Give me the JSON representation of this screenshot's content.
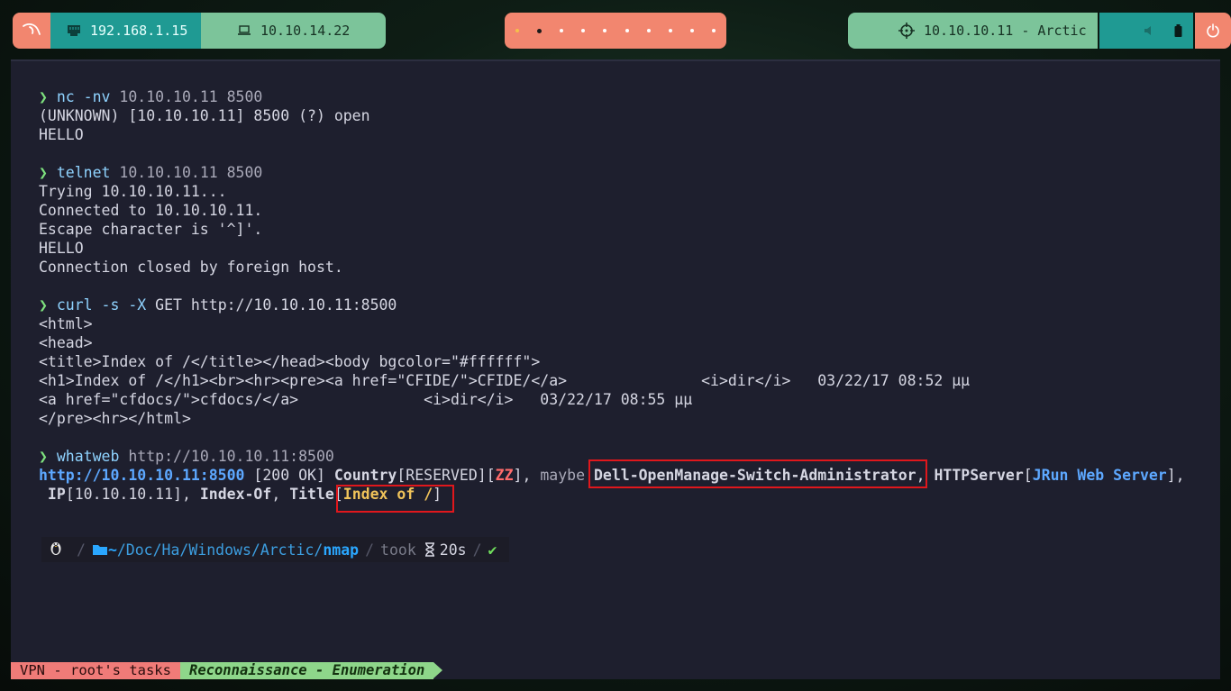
{
  "topbar": {
    "ethernet_ip": "192.168.1.15",
    "vpn_ip": "10.10.14.22",
    "target": "10.10.10.11 - Arctic",
    "workspaces": 10,
    "active_workspace": 2,
    "colors": {
      "coral": "#f2866f",
      "teal": "#1f9a93",
      "green": "#7cc49a"
    }
  },
  "terminal": {
    "lines": [
      {
        "prompt": "❯ ",
        "cmd": "nc -nv",
        "args": " 10.10.10.11 8500"
      },
      {
        "text": "(UNKNOWN) [10.10.10.11] 8500 (?) open"
      },
      {
        "text": "HELLO"
      },
      {
        "text": ""
      },
      {
        "prompt": "❯ ",
        "cmd": "telnet",
        "args": " 10.10.10.11 8500"
      },
      {
        "text": "Trying 10.10.10.11..."
      },
      {
        "text": "Connected to 10.10.10.11."
      },
      {
        "text": "Escape character is '^]'."
      },
      {
        "text": "HELLO"
      },
      {
        "text": "Connection closed by foreign host."
      },
      {
        "text": ""
      },
      {
        "prompt": "❯ ",
        "cmd": "curl -s -X",
        "args": " GET http://10.10.10.11:8500"
      },
      {
        "text": "<html>"
      },
      {
        "text": "<head>"
      },
      {
        "text": "<title>Index of /</title></head><body bgcolor=\"#ffffff\">"
      },
      {
        "text": "<h1>Index of /</h1><br><hr><pre><a href=\"CFIDE/\">CFIDE/</a>               <i>dir</i>   03/22/17 08:52 μμ"
      },
      {
        "text": "<a href=\"cfdocs/\">cfdocs/</a>              <i>dir</i>   03/22/17 08:55 μμ"
      },
      {
        "text": "</pre><hr></html>"
      },
      {
        "text": ""
      },
      {
        "prompt": "❯ ",
        "cmd": "whatweb",
        "args": " http://10.10.10.11:8500"
      }
    ],
    "whatweb": {
      "url": "http://10.10.10.11:8500",
      "status": " [200 OK] ",
      "country_label": "Country",
      "country_value": "[RESERVED][",
      "country_code": "ZZ",
      "country_end": "], ",
      "maybe": "maybe ",
      "device": "Dell-OpenManage-Switch-Administrator",
      "sep1": ", ",
      "httpserver_label": "HTTPServer",
      "httpserver_open": "[",
      "httpserver_value": "JRun Web Server",
      "httpserver_close": "],",
      "ip_label": " IP",
      "ip_value": "[10.10.10.11], ",
      "indexof": "Index-Of",
      "sep2": ", ",
      "title_label": "Title",
      "title_open": "[",
      "title_value": "Index of /",
      "title_close": "]"
    }
  },
  "prompt_line": {
    "path_home": "~",
    "path_mid": "/Doc/Ha/Windows/Arctic/",
    "path_cwd": "nmap",
    "took_label": "took",
    "duration": "20s",
    "status": "✔"
  },
  "tmux": {
    "session": "VPN - root's tasks",
    "window": "Reconnaissance - Enumeration"
  }
}
